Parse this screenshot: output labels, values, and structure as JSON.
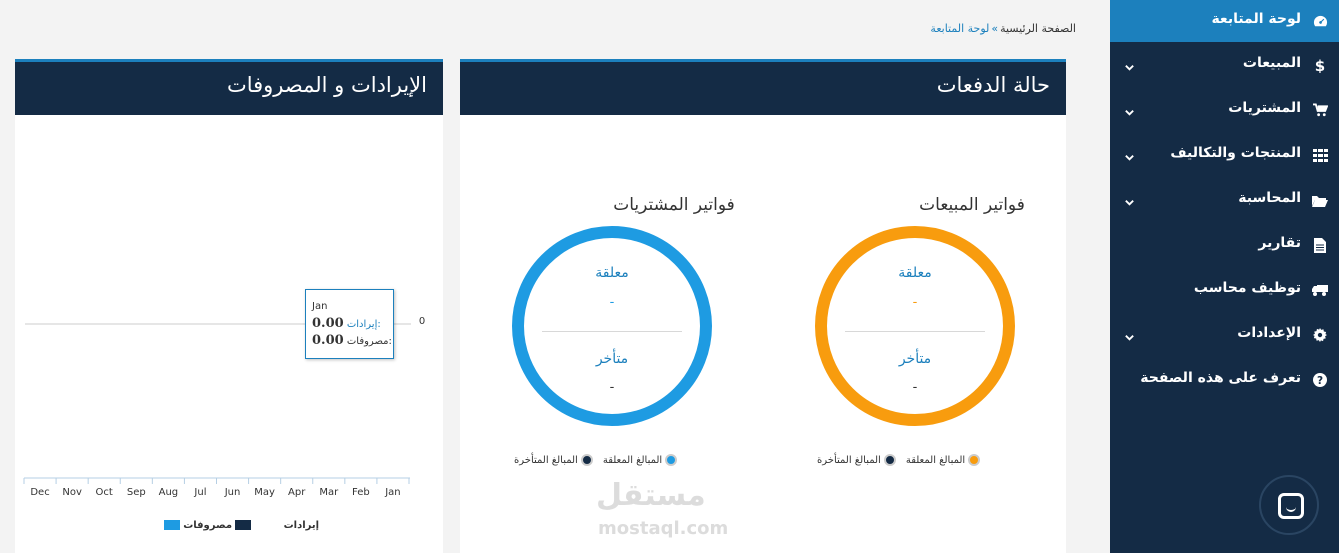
{
  "breadcrumb": {
    "home": "الصفحة الرئيسية",
    "separator": "»",
    "current": "لوحة المتابعة"
  },
  "sidebar": {
    "items": [
      {
        "label": "لوحة المتابعة",
        "icon": "dashboard-icon",
        "active": true
      },
      {
        "label": "المبيعات",
        "icon": "dollar-icon"
      },
      {
        "label": "المشتريات",
        "icon": "cart-icon"
      },
      {
        "label": "المنتجات والتكاليف",
        "icon": "grid-icon"
      },
      {
        "label": "المحاسبة",
        "icon": "folder-icon"
      },
      {
        "label": "تقارير",
        "icon": "file-icon"
      },
      {
        "label": "توظيف محاسب",
        "icon": "truck-icon"
      },
      {
        "label": "الإعدادات",
        "icon": "gear-icon"
      },
      {
        "label": "تعرف على هذه الصفحة",
        "icon": "question-icon"
      }
    ]
  },
  "payments_panel": {
    "title": "حالة الدفعات",
    "sales": {
      "title": "فواتير المبيعات",
      "pending_label": "معلقة",
      "pending_value": "-",
      "overdue_label": "متأخر",
      "overdue_value": "-",
      "legend_pending": "المبالغ المعلقة",
      "legend_overdue": "المبالغ المتأخرة",
      "color": "#f89c0e"
    },
    "purchases": {
      "title": "فواتير المشتريات",
      "pending_label": "معلقة",
      "pending_value": "-",
      "overdue_label": "متأخر",
      "overdue_value": "-",
      "legend_pending": "المبالغ المعلقة",
      "legend_overdue": "المبالغ المتأخرة",
      "color": "#1e9be2"
    }
  },
  "revenue_panel": {
    "title": "الإيرادات و المصروفات",
    "tooltip": {
      "month": "Jan",
      "revenue_label": "إيرادات:",
      "revenue_value": "0.00",
      "expense_label": "مصروفات:",
      "expense_value": "0.00"
    },
    "legend": {
      "expenses": "مصروفات",
      "revenue": "إيرادات"
    }
  },
  "chart_data": {
    "type": "line",
    "x": [
      "Dec",
      "Nov",
      "Oct",
      "Sep",
      "Aug",
      "Jul",
      "Jun",
      "May",
      "Apr",
      "Mar",
      "Feb",
      "Jan"
    ],
    "series": [
      {
        "name": "إيرادات",
        "values": [
          0,
          0,
          0,
          0,
          0,
          0,
          0,
          0,
          0,
          0,
          0,
          0
        ],
        "color": "#1e9be2"
      },
      {
        "name": "مصروفات",
        "values": [
          0,
          0,
          0,
          0,
          0,
          0,
          0,
          0,
          0,
          0,
          0,
          0
        ],
        "color": "#142b45"
      }
    ],
    "y_ticks": [
      "0"
    ],
    "grid": false,
    "legend": "bottom"
  },
  "watermark": {
    "arabic": "مستقل",
    "latin": "mostaql.com"
  }
}
